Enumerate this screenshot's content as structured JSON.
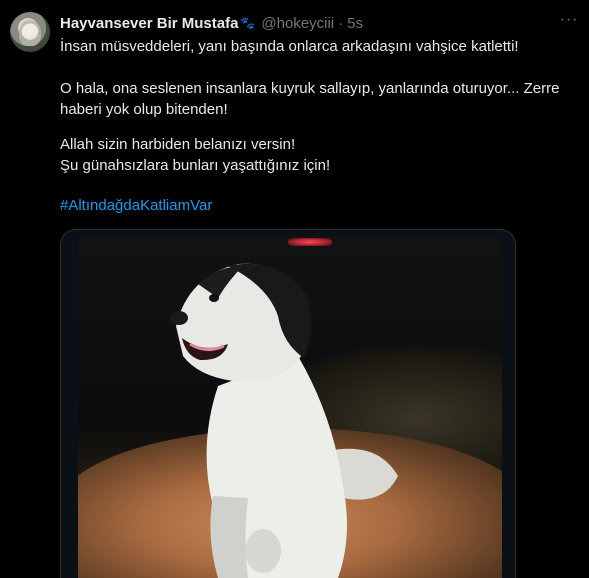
{
  "tweet": {
    "author_name": "Hayvansever Bir Mustafa",
    "author_badge_icon": "paw-icon",
    "handle": "@hokeyciii",
    "separator": "·",
    "time": "5s",
    "more_label": "···",
    "paragraph1": "İnsan müsveddeleri, yanı başında onlarca arkadaşını vahşice katletti!",
    "paragraph2": "O hala, ona seslenen insanlara kuyruk sallayıp, yanlarında oturuyor... Zerre haberi yok olup bitenden!",
    "paragraph3_line1": "Allah sizin harbiden belanızı versin!",
    "paragraph3_line2": "Şu günahsızlara bunları yaşattığınız için!",
    "hashtag": "#AltındağdaKatliamVar"
  },
  "colors": {
    "background": "#000000",
    "text": "#e7e9ea",
    "secondary": "#71767b",
    "link": "#1d9bf0",
    "border": "#2f3336"
  }
}
